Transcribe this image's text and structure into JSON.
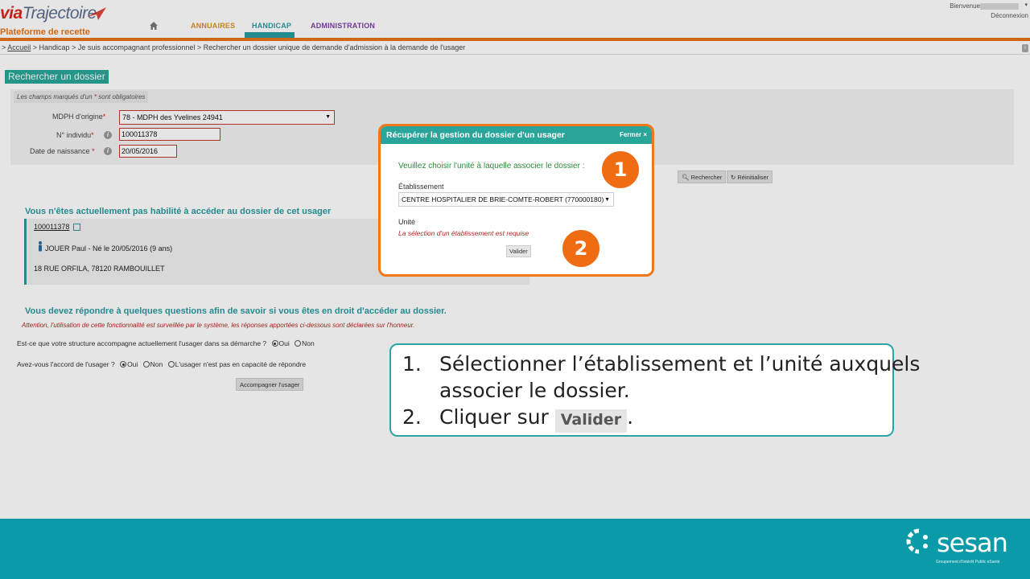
{
  "header": {
    "logo_via": "via",
    "logo_rest": "Trajectoire",
    "platform": "Plateforme de recette",
    "nav": [
      {
        "label": "ANNUAIRES"
      },
      {
        "label": "HANDICAP"
      },
      {
        "label": "ADMINISTRATION"
      }
    ],
    "bienvenue": "Bienvenue",
    "deconnexion": "Déconnexion"
  },
  "breadcrumb": {
    "prefix": "> ",
    "accueil": "Accueil",
    "rest": " > Handicap > Je suis accompagnant professionnel > Rechercher un dossier unique de demande d'admission à la demande de l'usager"
  },
  "search": {
    "title": "Rechercher un dossier",
    "required_note_a": "Les champs marqués d'un ",
    "required_note_star": "*",
    "required_note_b": " sont obligatoires",
    "mdph_label": "MDPH d'origine",
    "mdph_value": "78 - MDPH des Yvelines 24941",
    "individu_label": "N° individu",
    "individu_value": "100011378",
    "naissance_label": "Date de naissance",
    "naissance_value": "20/05/2016",
    "star": "*",
    "info": "i",
    "btn_rechercher": "Rechercher",
    "btn_reinitialiser": "Réinitialiser"
  },
  "patient": {
    "heading": "Vous n'êtes actuellement pas habilité à accéder au dossier de cet usager",
    "id": "100011378",
    "name": "JOUER Paul - Né le 20/05/2016 (9 ans)",
    "address": "18 RUE ORFILA, 78120 RAMBOUILLET"
  },
  "questions": {
    "heading": "Vous devez répondre à quelques questions afin de savoir si vous êtes en droit d'accéder au dossier.",
    "warning": "Attention, l'utilisation de cette fonctionnalité est surveillée par le système, les réponses apportées ci-dessous sont déclarées sur l'honneur.",
    "q1": "Est-ce que votre structure accompagne actuellement l'usager dans sa démarche ?",
    "q2": "Avez-vous l'accord de l'usager ?",
    "oui": "Oui",
    "non": "Non",
    "incapable": "L'usager n'est pas en capacité de répondre",
    "btn": "Accompagner l'usager"
  },
  "modal": {
    "title": "Récupérer la gestion du dossier d'un usager",
    "close": "Fermer ×",
    "prompt": "Veuillez choisir l'unité à laquelle associer le dossier :",
    "etab_label": "Établissement",
    "etab_value": "CENTRE HOSPITALIER DE BRIE-COMTE-ROBERT (770000180)",
    "unite_label": "Unité",
    "unite_error": "La sélection d'un établissement est requise",
    "valider": "Valider"
  },
  "badges": {
    "one": "1",
    "two": "2"
  },
  "callout": {
    "n1": "1.",
    "s1a": "Sélectionner l’établissement et l’unité auxquels",
    "s1b": "associer le dossier.",
    "n2": "2.",
    "s2": "Cliquer sur ",
    "s2_btn": "Valider",
    "s2_end": "."
  },
  "footer": {
    "brand": "sesan",
    "sub": "Groupement d’Intérêt Public eSanté"
  },
  "colors": {
    "teal": "#2aa599",
    "orange": "#e8731a",
    "footer": "#0b9aa8",
    "error_red": "#b3281f"
  }
}
